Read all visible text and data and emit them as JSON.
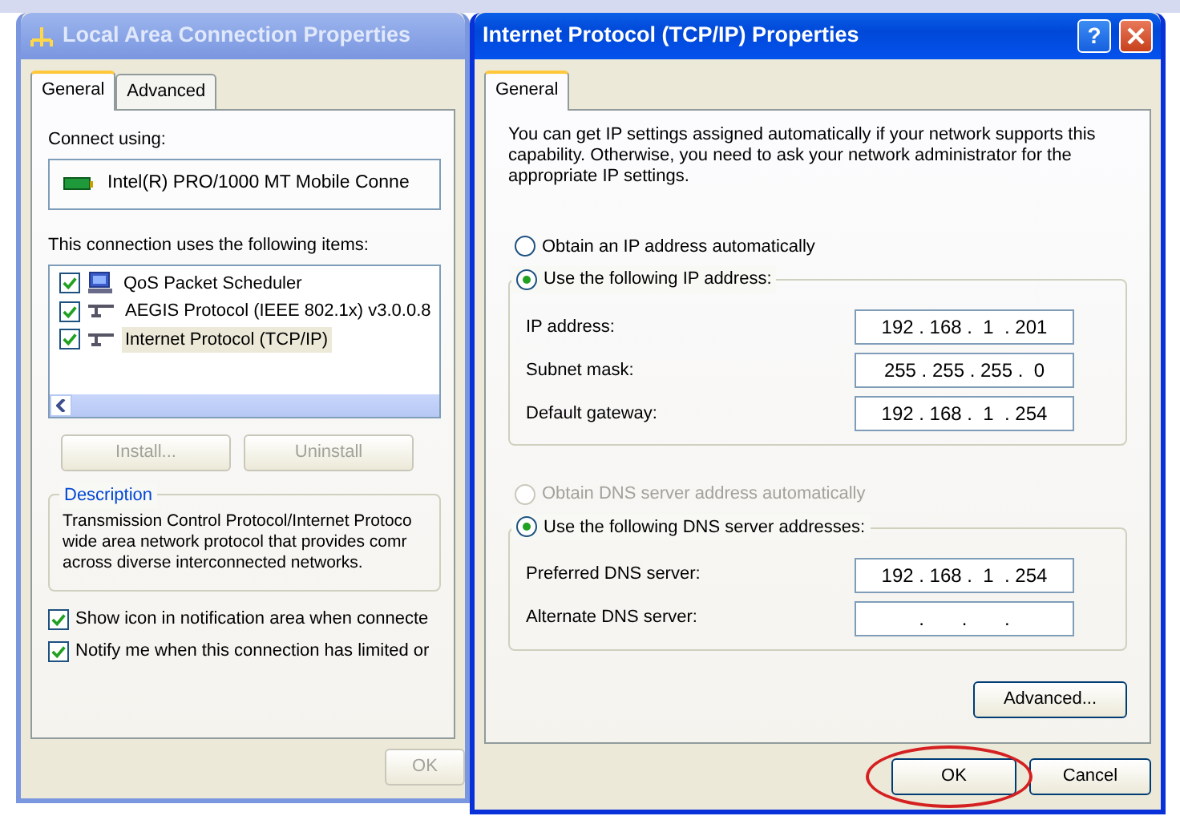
{
  "back_window": {
    "title": "Local Area Connection Properties",
    "active": false,
    "tabs": [
      {
        "label": "General",
        "selected": true
      },
      {
        "label": "Advanced",
        "selected": false
      }
    ],
    "connect_using_label": "Connect using:",
    "adapter": "Intel(R) PRO/1000 MT Mobile Conne",
    "items_label": "This connection uses the following items:",
    "items": [
      {
        "kind": "scheduler",
        "label": "QoS Packet Scheduler",
        "checked": true,
        "selected": false
      },
      {
        "kind": "protocol",
        "label": "AEGIS Protocol (IEEE 802.1x) v3.0.0.8",
        "checked": true,
        "selected": false
      },
      {
        "kind": "protocol",
        "label": "Internet Protocol (TCP/IP)",
        "checked": true,
        "selected": true
      }
    ],
    "buttons": [
      {
        "label": "Install...",
        "disabled": true
      },
      {
        "label": "Uninstall",
        "disabled": true
      }
    ],
    "description": {
      "legend": "Description",
      "text": "Transmission Control Protocol/Internet Protoco wide area network protocol that provides comr across diverse interconnected networks."
    },
    "options": [
      {
        "label": "Show icon in notification area when connecte",
        "checked": true
      },
      {
        "label": "Notify me when this connection has limited or",
        "checked": true
      }
    ],
    "ok_button": {
      "label": "OK",
      "disabled": true
    }
  },
  "front_window": {
    "title": "Internet Protocol (TCP/IP) Properties",
    "active": true,
    "help_button": "?",
    "tabs": [
      {
        "label": "General",
        "selected": true
      }
    ],
    "intro": "You can get IP settings assigned automatically if your network supports this capability. Otherwise, you need to ask your network administrator for the appropriate IP settings.",
    "ip_modes": [
      {
        "label": "Obtain an IP address automatically",
        "selected": false,
        "disabled": false
      },
      {
        "label": "Use the following IP address:",
        "selected": true,
        "disabled": false
      }
    ],
    "ip_fields": [
      {
        "label": "IP address:",
        "value": "192 . 168 .  1  . 201"
      },
      {
        "label": "Subnet mask:",
        "value": "255 . 255 . 255 .  0"
      },
      {
        "label": "Default gateway:",
        "value": "192 . 168 .  1  . 254"
      }
    ],
    "dns_modes": [
      {
        "label": "Obtain DNS server address automatically",
        "selected": false,
        "disabled": true
      },
      {
        "label": "Use the following DNS server addresses:",
        "selected": true,
        "disabled": false
      }
    ],
    "dns_fields": [
      {
        "label": "Preferred DNS server:",
        "value": "192 . 168 .  1  . 254"
      },
      {
        "label": "Alternate DNS server:",
        "value": ".       .       ."
      }
    ],
    "advanced_button": "Advanced...",
    "ok_button": {
      "label": "OK",
      "circled": true
    },
    "cancel_button": "Cancel"
  }
}
